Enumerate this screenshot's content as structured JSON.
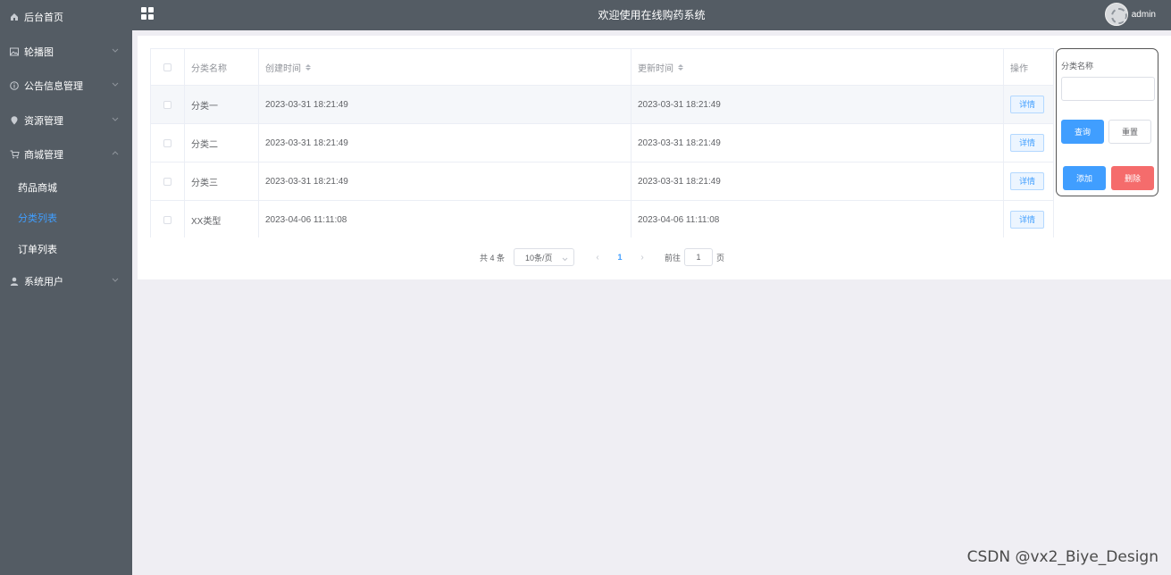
{
  "header": {
    "title": "欢迎使用在线购药系统",
    "username": "admin"
  },
  "sidebar": {
    "items": [
      {
        "label": "后台首页",
        "icon": "home-icon"
      },
      {
        "label": "轮播图",
        "icon": "picture-icon"
      },
      {
        "label": "公告信息管理",
        "icon": "info-icon"
      },
      {
        "label": "资源管理",
        "icon": "location-icon"
      },
      {
        "label": "商城管理",
        "icon": "cart-icon"
      },
      {
        "label": "系统用户",
        "icon": "user-icon"
      }
    ],
    "subitems": [
      {
        "label": "药品商城"
      },
      {
        "label": "分类列表",
        "active": true
      },
      {
        "label": "订单列表"
      }
    ]
  },
  "table": {
    "headers": {
      "name": "分类名称",
      "created": "创建时间",
      "updated": "更新时间",
      "actions": "操作"
    },
    "detail_label": "详情",
    "rows": [
      {
        "name": "分类一",
        "created": "2023-03-31 18:21:49",
        "updated": "2023-03-31 18:21:49"
      },
      {
        "name": "分类二",
        "created": "2023-03-31 18:21:49",
        "updated": "2023-03-31 18:21:49"
      },
      {
        "name": "分类三",
        "created": "2023-03-31 18:21:49",
        "updated": "2023-03-31 18:21:49"
      },
      {
        "name": "XX类型",
        "created": "2023-04-06 11:11:08",
        "updated": "2023-04-06 11:11:08"
      }
    ]
  },
  "search": {
    "label": "分类名称",
    "value": "",
    "query_label": "查询",
    "reset_label": "重置",
    "add_label": "添加",
    "delete_label": "删除"
  },
  "pagination": {
    "total": "共 4 条",
    "page_size": "10条/页",
    "current_page": "1",
    "goto_prefix": "前往",
    "goto_value": "1",
    "goto_suffix": "页"
  },
  "watermark": "CSDN @vx2_Biye_Design",
  "colors": {
    "sidebar_bg": "#545c64",
    "accent": "#409eff",
    "danger": "#f56c6c",
    "page_bg": "#efeef3"
  }
}
